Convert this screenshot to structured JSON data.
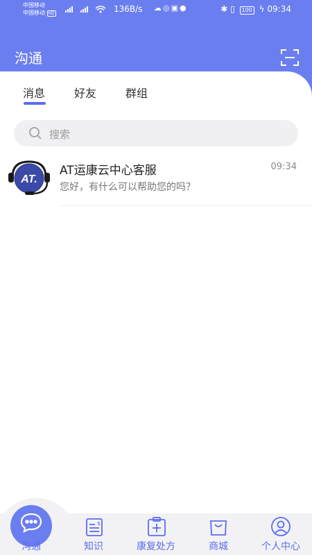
{
  "status_bar": {
    "carrier_1": "中国移动",
    "carrier_2": "中国移动",
    "hd": "HD",
    "net_speed": "136B/s",
    "battery": "100",
    "time": "09:34"
  },
  "header": {
    "title": "沟通"
  },
  "tabs": [
    {
      "label": "消息"
    },
    {
      "label": "好友"
    },
    {
      "label": "群组"
    }
  ],
  "search": {
    "placeholder": "搜索"
  },
  "chats": [
    {
      "name": "AT运康云中心客服",
      "time": "09:34",
      "preview": "您好，有什么可以帮助您的吗？",
      "avatar_text": "AT."
    }
  ],
  "bottom_nav": [
    {
      "label": "沟通",
      "icon": "chat-bubble-icon"
    },
    {
      "label": "知识",
      "icon": "document-icon"
    },
    {
      "label": "康复处方",
      "icon": "medical-kit-icon"
    },
    {
      "label": "商城",
      "icon": "shopping-bag-icon"
    },
    {
      "label": "个人中心",
      "icon": "user-icon"
    }
  ],
  "colors": {
    "primary": "#6b7ef0",
    "accent": "#5b6df0",
    "background": "#ffffff"
  }
}
